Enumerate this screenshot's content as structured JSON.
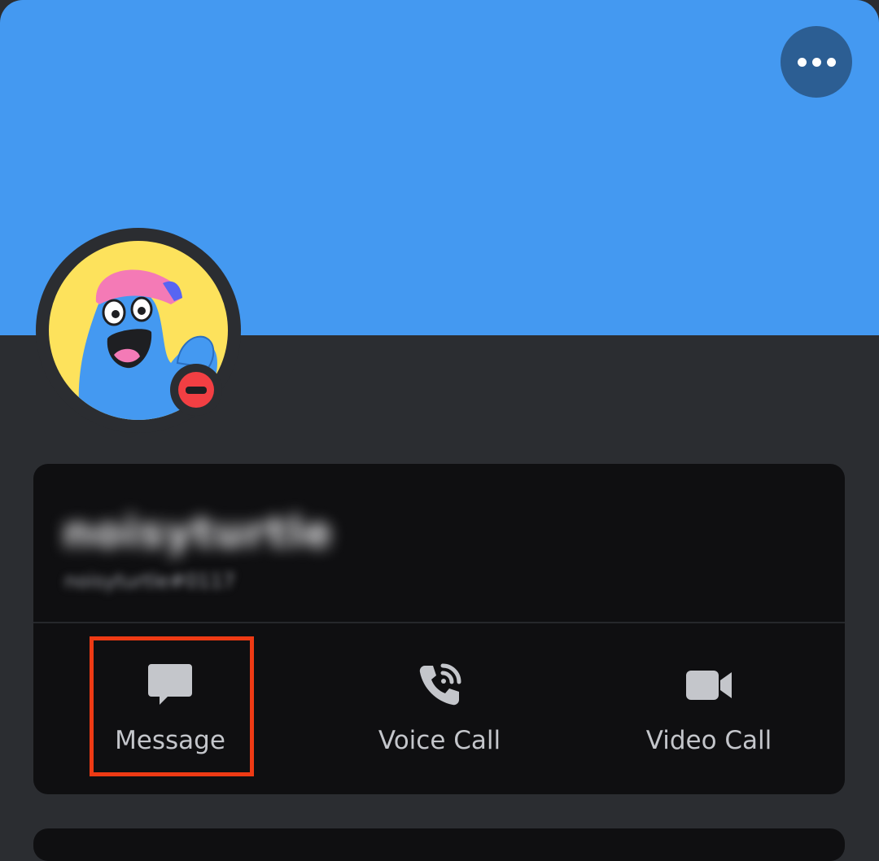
{
  "profile": {
    "display_name": "noisyturtle",
    "username": "noisyturtle#0117",
    "status": "do-not-disturb",
    "status_color": "#f23f43",
    "banner_color": "#4499f1"
  },
  "header": {
    "more_icon": "more-horizontal-icon"
  },
  "actions": [
    {
      "label": "Message",
      "icon": "chat-bubble-icon"
    },
    {
      "label": "Voice Call",
      "icon": "phone-call-icon"
    },
    {
      "label": "Video Call",
      "icon": "video-camera-icon"
    }
  ],
  "highlight_color": "#ee3a14"
}
